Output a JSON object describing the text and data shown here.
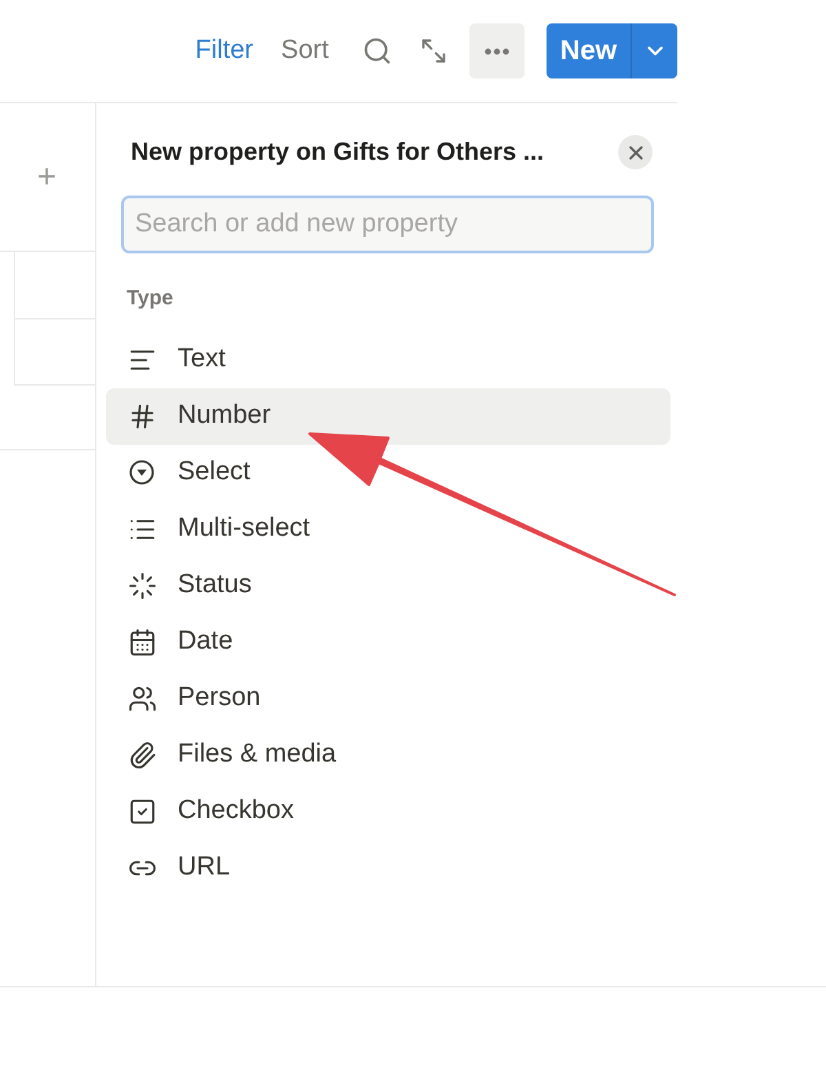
{
  "toolbar": {
    "filter": "Filter",
    "sort": "Sort",
    "new_button": "New"
  },
  "table": {
    "add_column": "+"
  },
  "panel": {
    "title": "New property on Gifts for Others ...",
    "search": {
      "placeholder": "Search or add new property"
    },
    "section_label": "Type",
    "types": [
      {
        "kind": "text",
        "label": "Text",
        "selected": false
      },
      {
        "kind": "number",
        "label": "Number",
        "selected": true
      },
      {
        "kind": "select",
        "label": "Select",
        "selected": false
      },
      {
        "kind": "multiselect",
        "label": "Multi-select",
        "selected": false
      },
      {
        "kind": "status",
        "label": "Status",
        "selected": false
      },
      {
        "kind": "date",
        "label": "Date",
        "selected": false
      },
      {
        "kind": "person",
        "label": "Person",
        "selected": false
      },
      {
        "kind": "files",
        "label": "Files & media",
        "selected": false
      },
      {
        "kind": "checkbox",
        "label": "Checkbox",
        "selected": false
      },
      {
        "kind": "url",
        "label": "URL",
        "selected": false
      }
    ]
  }
}
